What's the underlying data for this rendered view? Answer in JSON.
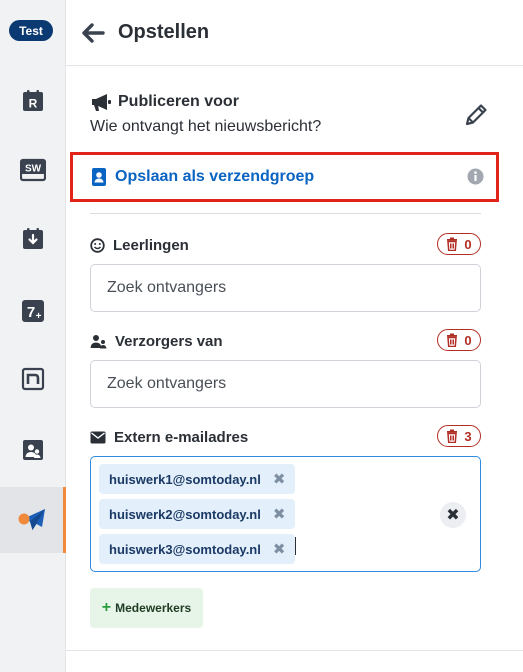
{
  "sidebar": {
    "env_badge": "Test",
    "items": [
      {
        "icon": "roster-r-icon",
        "active": false
      },
      {
        "icon": "studiewijzer-sw-icon",
        "active": false
      },
      {
        "icon": "calendar-download-icon",
        "active": false
      },
      {
        "icon": "grade-seven-plus-icon",
        "active": false
      },
      {
        "icon": "notes-n-icon",
        "active": false
      },
      {
        "icon": "people-card-icon",
        "active": false
      },
      {
        "icon": "paper-plane-icon",
        "active": true
      }
    ],
    "accent_color": "#f08a3a"
  },
  "header": {
    "title": "Opstellen"
  },
  "publish": {
    "title": "Publiceren voor",
    "subtitle": "Wie ontvangt het nieuwsbericht?"
  },
  "save_group": {
    "label": "Opslaan als verzendgroep",
    "highlight_color": "#e2231a"
  },
  "fields": {
    "students": {
      "label": "Leerlingen",
      "count": "0",
      "placeholder": "Zoek ontvangers"
    },
    "guardians": {
      "label": "Verzorgers van",
      "count": "0",
      "placeholder": "Zoek ontvangers"
    },
    "external": {
      "label": "Extern e-mailadres",
      "count": "3",
      "chips": [
        "huiswerk1@somtoday.nl",
        "huiswerk2@somtoday.nl",
        "huiswerk3@somtoday.nl"
      ],
      "remove_symbol": "✖",
      "clear_symbol": "✖"
    }
  },
  "add_staff": {
    "plus": "+",
    "label": "Medewerkers"
  },
  "colors": {
    "link_blue": "#0a64c2",
    "danger": "#b22e25",
    "focus_blue": "#2f8be0"
  }
}
